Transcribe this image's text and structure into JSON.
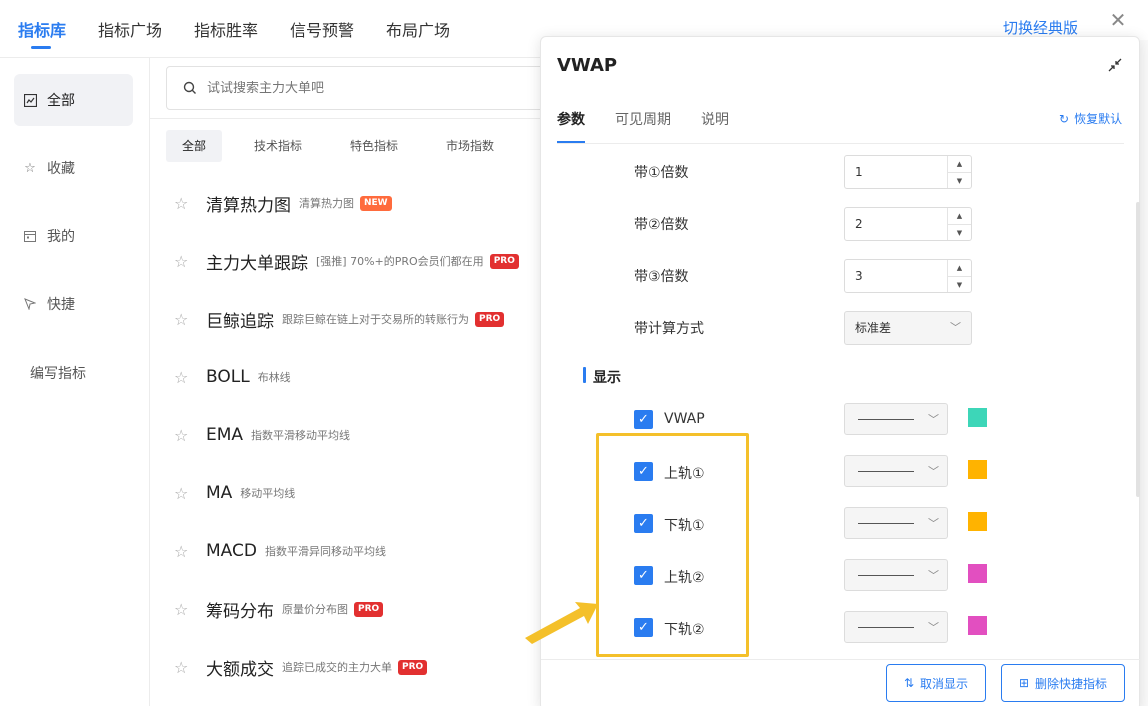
{
  "topbar": {
    "tabs": [
      "指标库",
      "指标广场",
      "指标胜率",
      "信号预警",
      "布局广场"
    ],
    "active_tab": "指标库",
    "switch_label": "切换经典版",
    "close_label": "✕"
  },
  "sidebar": {
    "items": [
      {
        "icon": "chart-icon",
        "label": "全部",
        "active": true
      },
      {
        "icon": "star-icon",
        "label": "收藏"
      },
      {
        "icon": "calendar-icon",
        "label": "我的"
      },
      {
        "icon": "cursor-icon",
        "label": "快捷"
      }
    ],
    "write_label": "编写指标"
  },
  "search": {
    "placeholder": "试试搜索主力大单吧"
  },
  "categories": [
    "全部",
    "技术指标",
    "特色指标",
    "市场指数"
  ],
  "indicators": [
    {
      "name": "清算热力图",
      "desc": "清算热力图",
      "badge": "NEW"
    },
    {
      "name": "主力大单跟踪",
      "desc": "[强推] 70%+的PRO会员们都在用",
      "badge": "PRO"
    },
    {
      "name": "巨鲸追踪",
      "desc": "跟踪巨鲸在链上对于交易所的转账行为",
      "badge": "PRO"
    },
    {
      "name": "BOLL",
      "desc": "布林线",
      "badge": ""
    },
    {
      "name": "EMA",
      "desc": "指数平滑移动平均线",
      "badge": ""
    },
    {
      "name": "MA",
      "desc": "移动平均线",
      "badge": ""
    },
    {
      "name": "MACD",
      "desc": "指数平滑异同移动平均线",
      "badge": ""
    },
    {
      "name": "筹码分布",
      "desc": "原量价分布图",
      "badge": "PRO"
    },
    {
      "name": "大额成交",
      "desc": "追踪已成交的主力大单",
      "badge": "PRO"
    }
  ],
  "panel": {
    "title": "VWAP",
    "tabs": [
      "参数",
      "可见周期",
      "说明"
    ],
    "active_tab": "参数",
    "reset_label": "恢复默认",
    "params": [
      {
        "label": "带①倍数",
        "value": "1"
      },
      {
        "label": "带②倍数",
        "value": "2"
      },
      {
        "label": "带③倍数",
        "value": "3"
      }
    ],
    "calc_method": {
      "label": "带计算方式",
      "value": "标准差"
    },
    "display_section": "显示",
    "display_items": [
      {
        "label": "VWAP",
        "checked": true,
        "color": "#3dd6b8"
      },
      {
        "label": "上轨①",
        "checked": true,
        "color": "#ffb300"
      },
      {
        "label": "下轨①",
        "checked": true,
        "color": "#ffb300"
      },
      {
        "label": "上轨②",
        "checked": true,
        "color": "#e24fc0"
      },
      {
        "label": "下轨②",
        "checked": true,
        "color": "#e24fc0"
      }
    ],
    "footer": {
      "cancel_display": "取消显示",
      "delete_shortcut": "删除快捷指标"
    }
  },
  "highlight_color": "#f4c02a"
}
